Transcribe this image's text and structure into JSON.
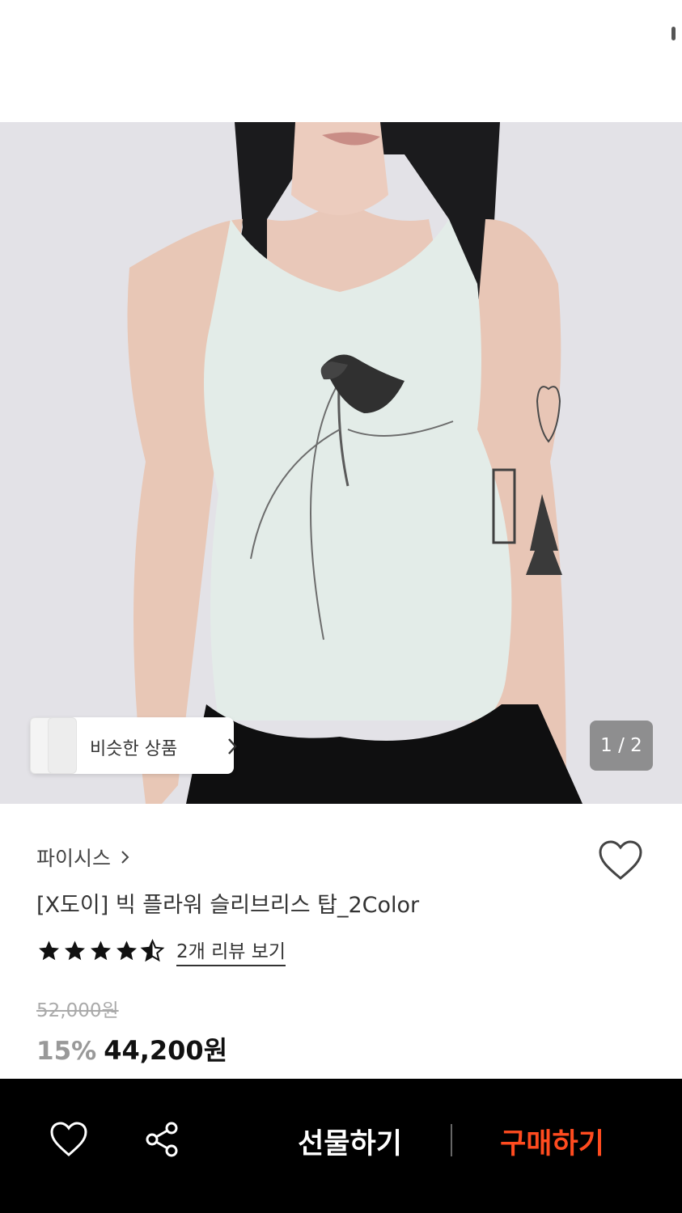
{
  "hero": {
    "similar_button_label": "비슷한 상품",
    "pager_text": "1 / 2"
  },
  "product": {
    "brand": "파이시스",
    "title": "[X도이] 빅 플라워 슬리브리스 탑_2Color",
    "rating": 4.5,
    "review_link": "2개 리뷰 보기",
    "original_price": "52,000원",
    "discount": "15%",
    "price": "44,200원"
  },
  "bottom_bar": {
    "gift_label": "선물하기",
    "buy_label": "구매하기"
  },
  "icons": {
    "like": "heart-icon",
    "share": "share-icon",
    "chevron": "chevron-right-icon",
    "star": "star-icon"
  },
  "colors": {
    "buy_accent": "#ff4b1f",
    "bottom_bar_bg": "#000000",
    "star": "#111111"
  }
}
